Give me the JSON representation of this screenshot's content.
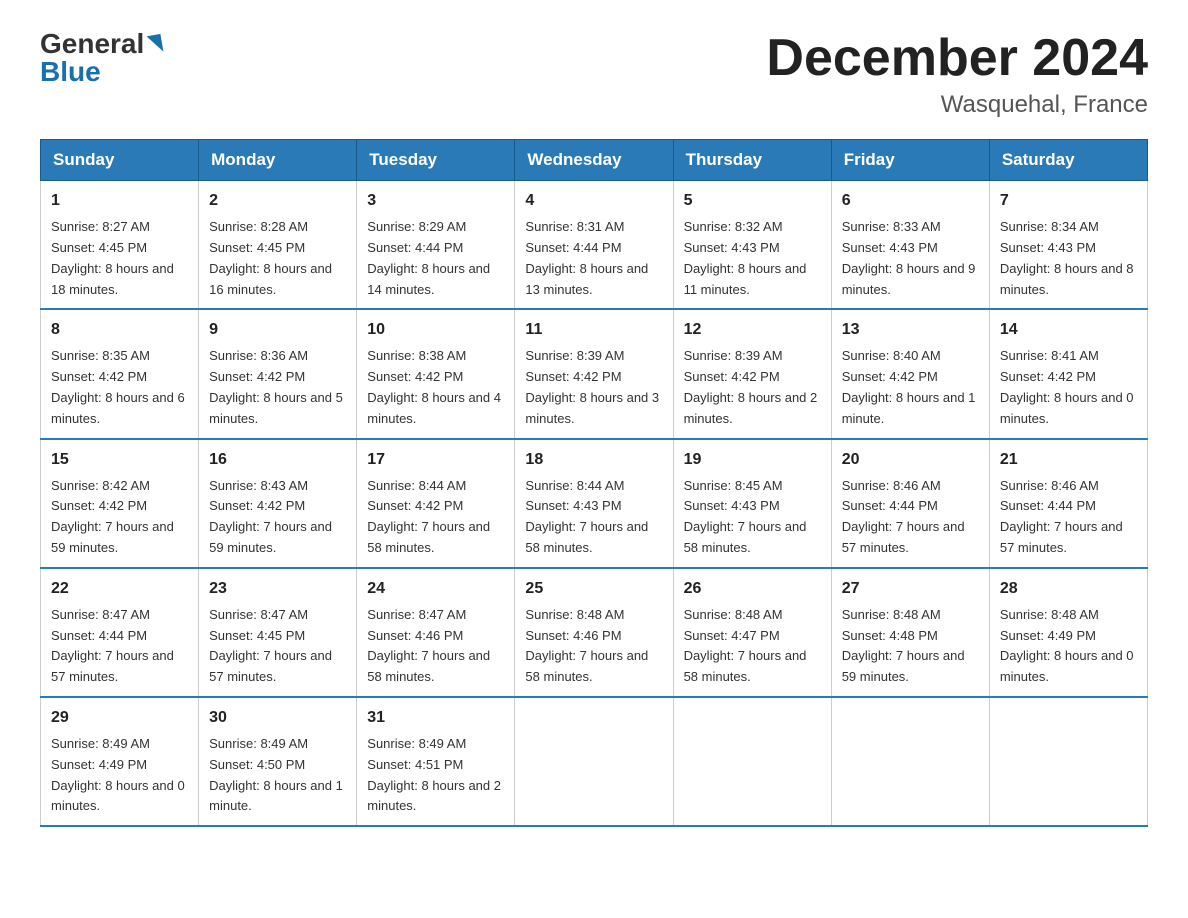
{
  "header": {
    "logo": {
      "general": "General",
      "blue": "Blue"
    },
    "title": "December 2024",
    "location": "Wasquehal, France"
  },
  "calendar": {
    "days_of_week": [
      "Sunday",
      "Monday",
      "Tuesday",
      "Wednesday",
      "Thursday",
      "Friday",
      "Saturday"
    ],
    "weeks": [
      [
        {
          "day": "1",
          "sunrise": "8:27 AM",
          "sunset": "4:45 PM",
          "daylight": "8 hours and 18 minutes."
        },
        {
          "day": "2",
          "sunrise": "8:28 AM",
          "sunset": "4:45 PM",
          "daylight": "8 hours and 16 minutes."
        },
        {
          "day": "3",
          "sunrise": "8:29 AM",
          "sunset": "4:44 PM",
          "daylight": "8 hours and 14 minutes."
        },
        {
          "day": "4",
          "sunrise": "8:31 AM",
          "sunset": "4:44 PM",
          "daylight": "8 hours and 13 minutes."
        },
        {
          "day": "5",
          "sunrise": "8:32 AM",
          "sunset": "4:43 PM",
          "daylight": "8 hours and 11 minutes."
        },
        {
          "day": "6",
          "sunrise": "8:33 AM",
          "sunset": "4:43 PM",
          "daylight": "8 hours and 9 minutes."
        },
        {
          "day": "7",
          "sunrise": "8:34 AM",
          "sunset": "4:43 PM",
          "daylight": "8 hours and 8 minutes."
        }
      ],
      [
        {
          "day": "8",
          "sunrise": "8:35 AM",
          "sunset": "4:42 PM",
          "daylight": "8 hours and 6 minutes."
        },
        {
          "day": "9",
          "sunrise": "8:36 AM",
          "sunset": "4:42 PM",
          "daylight": "8 hours and 5 minutes."
        },
        {
          "day": "10",
          "sunrise": "8:38 AM",
          "sunset": "4:42 PM",
          "daylight": "8 hours and 4 minutes."
        },
        {
          "day": "11",
          "sunrise": "8:39 AM",
          "sunset": "4:42 PM",
          "daylight": "8 hours and 3 minutes."
        },
        {
          "day": "12",
          "sunrise": "8:39 AM",
          "sunset": "4:42 PM",
          "daylight": "8 hours and 2 minutes."
        },
        {
          "day": "13",
          "sunrise": "8:40 AM",
          "sunset": "4:42 PM",
          "daylight": "8 hours and 1 minute."
        },
        {
          "day": "14",
          "sunrise": "8:41 AM",
          "sunset": "4:42 PM",
          "daylight": "8 hours and 0 minutes."
        }
      ],
      [
        {
          "day": "15",
          "sunrise": "8:42 AM",
          "sunset": "4:42 PM",
          "daylight": "7 hours and 59 minutes."
        },
        {
          "day": "16",
          "sunrise": "8:43 AM",
          "sunset": "4:42 PM",
          "daylight": "7 hours and 59 minutes."
        },
        {
          "day": "17",
          "sunrise": "8:44 AM",
          "sunset": "4:42 PM",
          "daylight": "7 hours and 58 minutes."
        },
        {
          "day": "18",
          "sunrise": "8:44 AM",
          "sunset": "4:43 PM",
          "daylight": "7 hours and 58 minutes."
        },
        {
          "day": "19",
          "sunrise": "8:45 AM",
          "sunset": "4:43 PM",
          "daylight": "7 hours and 58 minutes."
        },
        {
          "day": "20",
          "sunrise": "8:46 AM",
          "sunset": "4:44 PM",
          "daylight": "7 hours and 57 minutes."
        },
        {
          "day": "21",
          "sunrise": "8:46 AM",
          "sunset": "4:44 PM",
          "daylight": "7 hours and 57 minutes."
        }
      ],
      [
        {
          "day": "22",
          "sunrise": "8:47 AM",
          "sunset": "4:44 PM",
          "daylight": "7 hours and 57 minutes."
        },
        {
          "day": "23",
          "sunrise": "8:47 AM",
          "sunset": "4:45 PM",
          "daylight": "7 hours and 57 minutes."
        },
        {
          "day": "24",
          "sunrise": "8:47 AM",
          "sunset": "4:46 PM",
          "daylight": "7 hours and 58 minutes."
        },
        {
          "day": "25",
          "sunrise": "8:48 AM",
          "sunset": "4:46 PM",
          "daylight": "7 hours and 58 minutes."
        },
        {
          "day": "26",
          "sunrise": "8:48 AM",
          "sunset": "4:47 PM",
          "daylight": "7 hours and 58 minutes."
        },
        {
          "day": "27",
          "sunrise": "8:48 AM",
          "sunset": "4:48 PM",
          "daylight": "7 hours and 59 minutes."
        },
        {
          "day": "28",
          "sunrise": "8:48 AM",
          "sunset": "4:49 PM",
          "daylight": "8 hours and 0 minutes."
        }
      ],
      [
        {
          "day": "29",
          "sunrise": "8:49 AM",
          "sunset": "4:49 PM",
          "daylight": "8 hours and 0 minutes."
        },
        {
          "day": "30",
          "sunrise": "8:49 AM",
          "sunset": "4:50 PM",
          "daylight": "8 hours and 1 minute."
        },
        {
          "day": "31",
          "sunrise": "8:49 AM",
          "sunset": "4:51 PM",
          "daylight": "8 hours and 2 minutes."
        },
        null,
        null,
        null,
        null
      ]
    ]
  }
}
